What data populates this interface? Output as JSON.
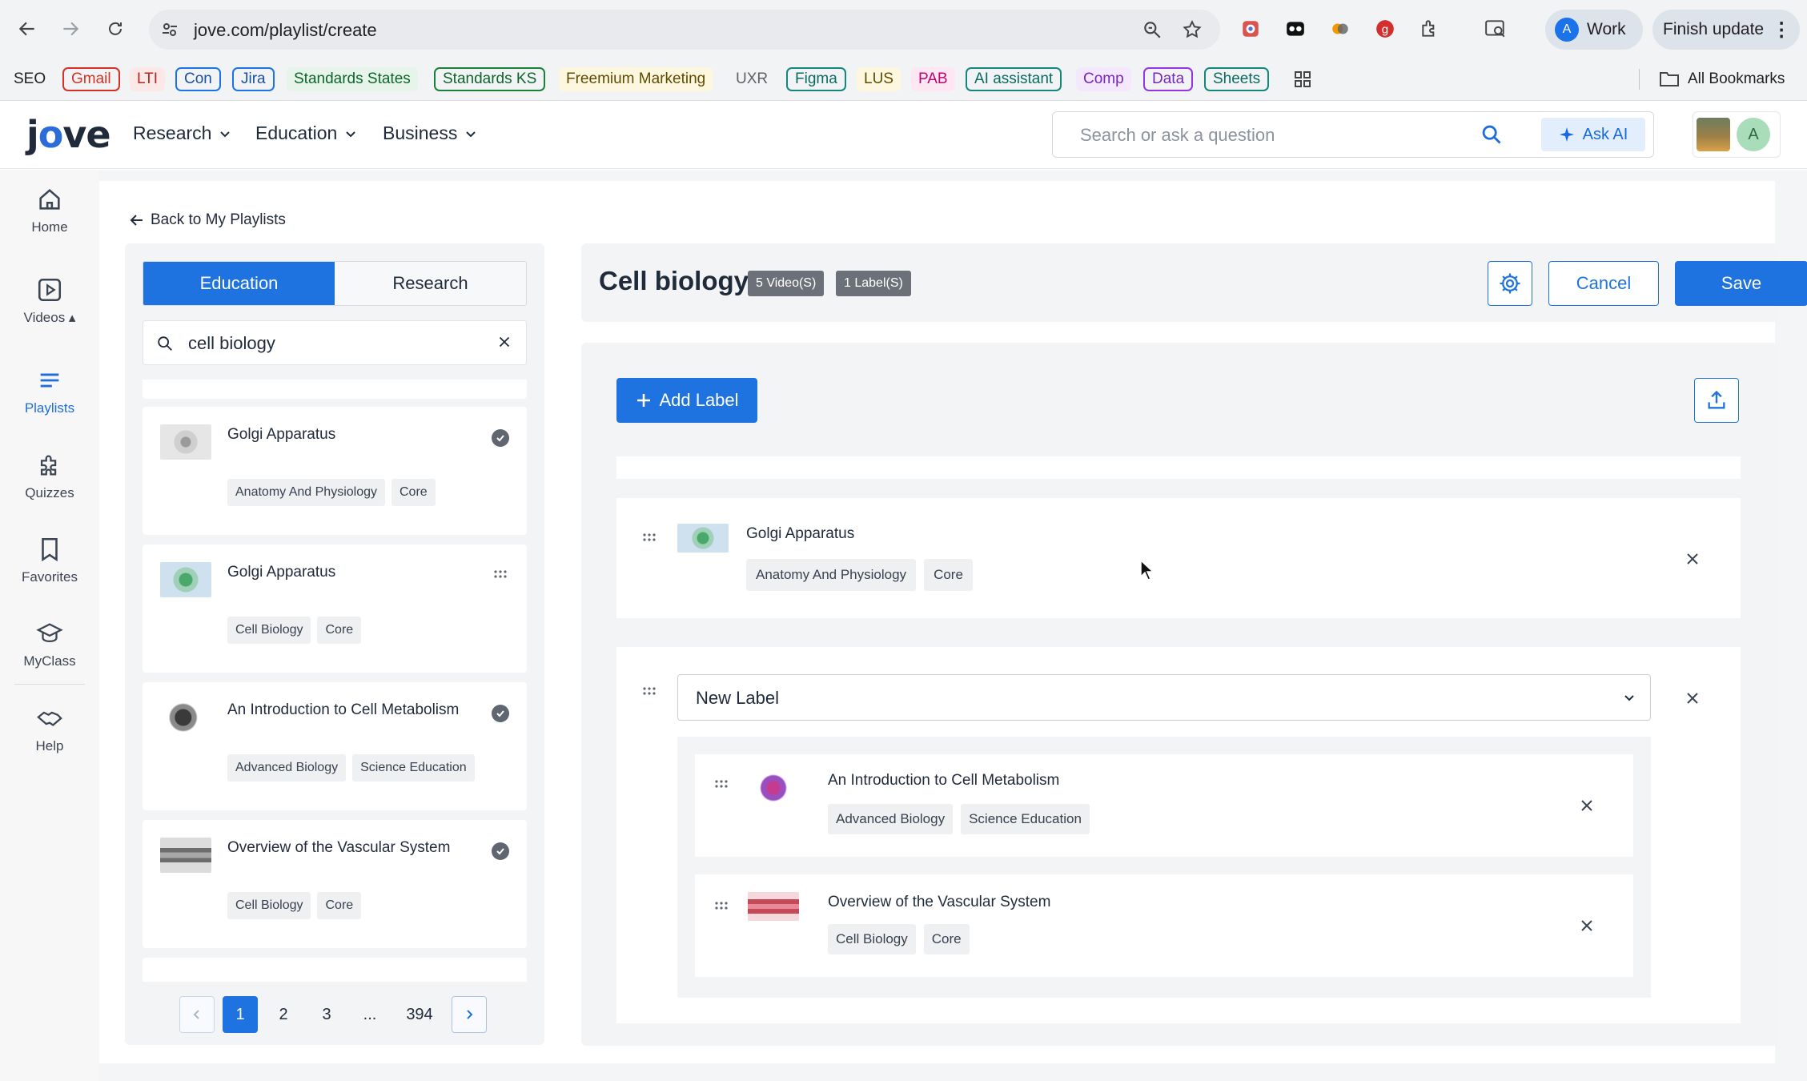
{
  "browser": {
    "url": "jove.com/playlist/create",
    "profile_label": "Work",
    "profile_initial": "A",
    "update_label": "Finish update",
    "bookmarks": [
      {
        "label": "SEO",
        "style": "plain"
      },
      {
        "label": "Gmail",
        "style": "red"
      },
      {
        "label": "LTI",
        "style": "lt-red"
      },
      {
        "label": "Con",
        "style": "blue"
      },
      {
        "label": "Jira",
        "style": "blue"
      },
      {
        "label": "Standards States",
        "style": "lt-green"
      },
      {
        "label": "Standards KS",
        "style": "green"
      },
      {
        "label": "Freemium Marketing",
        "style": "lt-yellow"
      },
      {
        "label": "UXR",
        "style": "lt-grey"
      },
      {
        "label": "Figma",
        "style": "teal"
      },
      {
        "label": "LUS",
        "style": "lt-yellow"
      },
      {
        "label": "PAB",
        "style": "lt-pink"
      },
      {
        "label": "AI assistant",
        "style": "teal"
      },
      {
        "label": "Comp",
        "style": "lt-purple"
      },
      {
        "label": "Data",
        "style": "purple"
      },
      {
        "label": "Sheets",
        "style": "teal"
      }
    ],
    "all_bookmarks": "All Bookmarks"
  },
  "header": {
    "logo": "jove",
    "nav": [
      "Research",
      "Education",
      "Business"
    ],
    "search_placeholder": "Search or ask a question",
    "ask_ai": "Ask AI",
    "avatar_initial": "A"
  },
  "rail": {
    "items": [
      {
        "label": "Home",
        "icon": "home-icon"
      },
      {
        "label": "Videos ▴",
        "icon": "video-icon"
      },
      {
        "label": "Playlists",
        "icon": "playlist-icon"
      },
      {
        "label": "Quizzes",
        "icon": "puzzle-icon"
      },
      {
        "label": "Favorites",
        "icon": "bookmark-icon"
      },
      {
        "label": "MyClass",
        "icon": "graduation-cap-icon"
      },
      {
        "label": "Help",
        "icon": "handshake-icon"
      }
    ],
    "active": "Playlists"
  },
  "page": {
    "back_link": "Back to My Playlists"
  },
  "library": {
    "tabs": [
      "Education",
      "Research"
    ],
    "active_tab": "Education",
    "search_value": "cell biology",
    "results": [
      {
        "title": "Golgi Apparatus",
        "tags": [
          "Anatomy And Physiology",
          "Core"
        ],
        "added": true
      },
      {
        "title": "Golgi Apparatus",
        "tags": [
          "Cell Biology",
          "Core"
        ],
        "added": false
      },
      {
        "title": "An Introduction to Cell Metabolism",
        "tags": [
          "Advanced Biology",
          "Science Education"
        ],
        "added": true
      },
      {
        "title": "Overview of the Vascular System",
        "tags": [
          "Cell Biology",
          "Core"
        ],
        "added": true
      }
    ],
    "pagination": {
      "pages": [
        "1",
        "2",
        "3",
        "...",
        "394"
      ],
      "current": "1"
    }
  },
  "playlist": {
    "title": "Cell biology",
    "videos_badge": "5 Video(S)",
    "labels_badge": "1 Label(S)",
    "cancel": "Cancel",
    "save": "Save",
    "add_label": "Add Label",
    "top_item": {
      "title": "Golgi Apparatus",
      "tags": [
        "Anatomy And Physiology",
        "Core"
      ]
    },
    "label_group": {
      "label_value": "New Label",
      "items": [
        {
          "title": "An Introduction to Cell Metabolism",
          "tags": [
            "Advanced Biology",
            "Science Education"
          ]
        },
        {
          "title": "Overview of the Vascular System",
          "tags": [
            "Cell Biology",
            "Core"
          ]
        }
      ]
    }
  },
  "colors": {
    "accent": "#1f73e0",
    "badge": "#6b7079",
    "tag_bg": "#eef0f2"
  }
}
